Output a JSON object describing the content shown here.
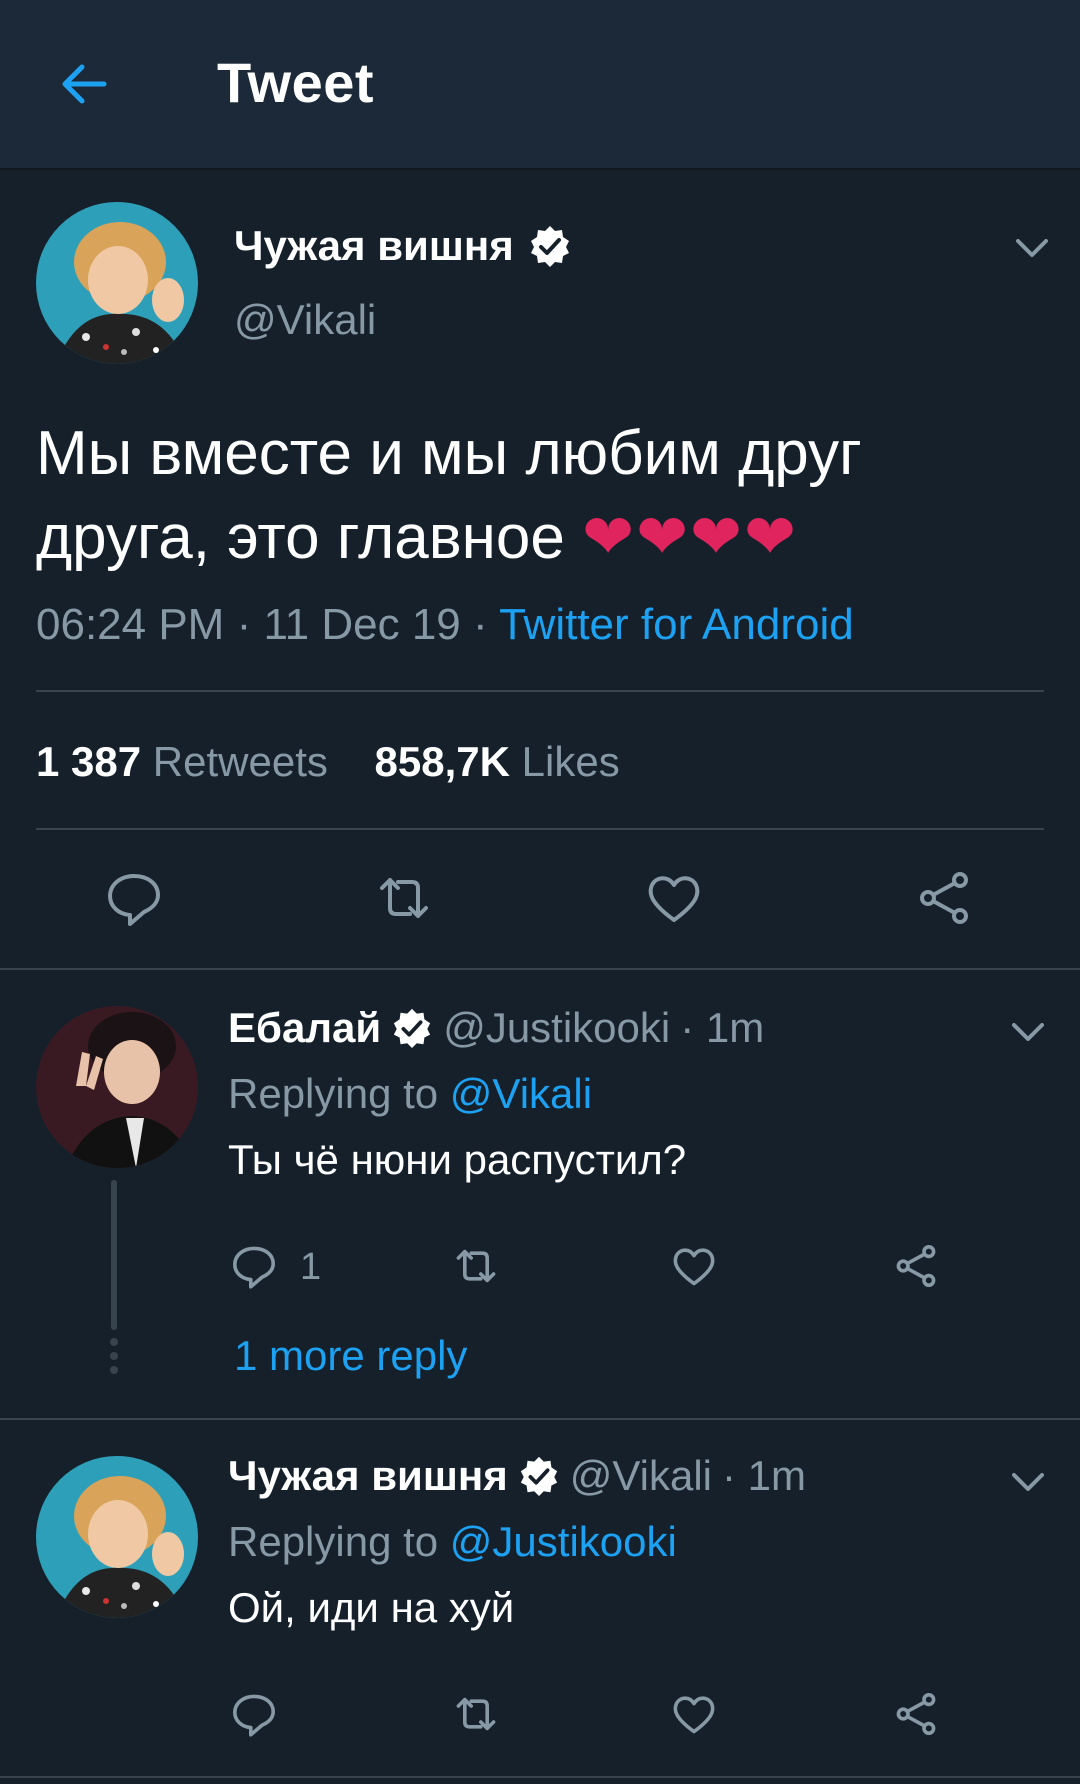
{
  "header": {
    "title": "Tweet",
    "back_icon": "arrow-left-icon"
  },
  "colors": {
    "background": "#15202b",
    "header": "#1c2938",
    "accent": "#1da1f2",
    "muted": "#8899a6",
    "divider": "#38444d",
    "heart": "#e0245e"
  },
  "main_tweet": {
    "author_name": "Чужая вишня",
    "author_handle": "@Vikali",
    "verified": true,
    "text": "Мы вместе и мы любим друг друга, это главное",
    "emoji": "❤❤❤❤",
    "time": "06:24 PM",
    "date": "11 Dec 19",
    "separator": "·",
    "source": "Twitter for Android",
    "retweet_count": "1 387",
    "retweet_label": "Retweets",
    "like_count": "858,7K",
    "like_label": "Likes"
  },
  "replies": [
    {
      "author_name": "Ебалай",
      "author_handle": "@Justikooki",
      "time": "· 1m",
      "replying_label": "Replying to",
      "replying_to": "@Vikali",
      "text": "Ты чё нюни распустил?",
      "reply_count": "1",
      "more_replies": "1 more reply"
    },
    {
      "author_name": "Чужая вишня",
      "author_handle": "@Vikali",
      "time": "· 1m",
      "replying_label": "Replying to",
      "replying_to": "@Justikooki",
      "text": "Ой, иди на хуй"
    }
  ]
}
